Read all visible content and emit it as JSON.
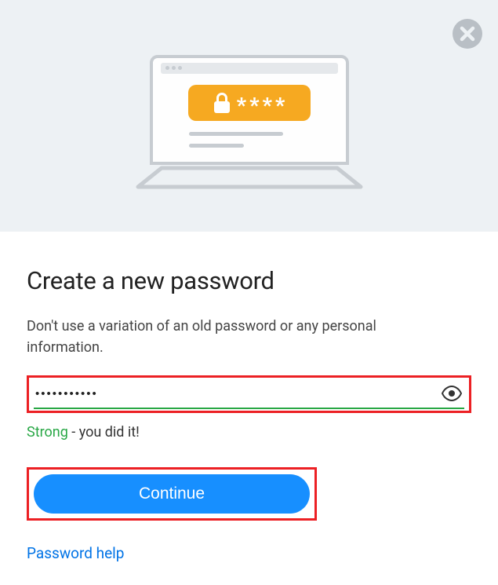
{
  "heading": "Create a new password",
  "description": "Don't use a variation of an old password or any personal information.",
  "password_value": "•••••••••••",
  "strength": {
    "label": "Strong",
    "suffix": " - you did it!"
  },
  "continue_label": "Continue",
  "help_link_label": "Password help",
  "colors": {
    "accent": "#178fff",
    "highlight_border": "#ec2024",
    "strength_ok": "#28a745",
    "hero_bg": "#edf1f4",
    "illustration_accent": "#f6a921"
  }
}
